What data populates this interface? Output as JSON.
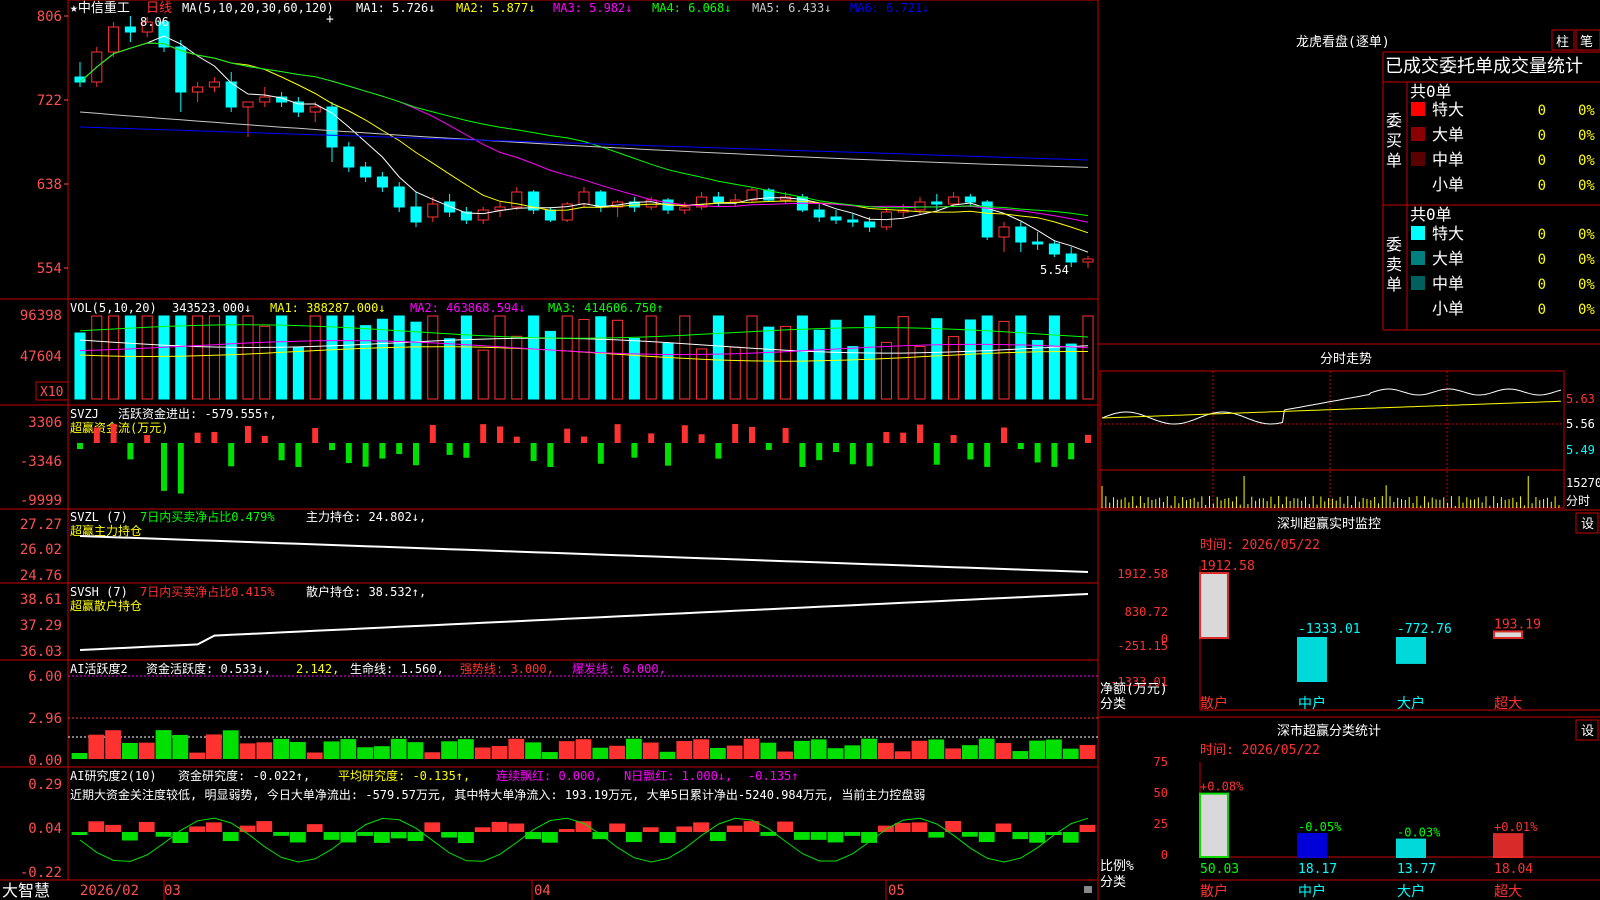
{
  "colors": {
    "up": "#ff3232",
    "down": "#00ffff",
    "frame": "#c80000",
    "axis_text": "#ff5050",
    "ma1": "#ffffff",
    "ma2": "#ffff00",
    "ma3": "#ff00ff",
    "ma4": "#00ff00",
    "ma5": "#c8c8c8",
    "ma6": "#0000ff",
    "green_bar": "#00e000",
    "label_yellow": "#ffff00",
    "title_white": "#ffffff"
  },
  "main": {
    "stock_name": "★中信重工",
    "period": "日线",
    "ma_params": "MA(5,10,20,30,60,120)",
    "ma1": "MA1: 5.726↓",
    "ma2": "MA2: 5.877↓",
    "ma3": "MA3: 5.982↓",
    "ma4": "MA4: 6.068↓",
    "ma5": "MA5: 6.433↓",
    "ma6": "MA6: 6.721↓",
    "cross": "+",
    "high_label": "8.06",
    "low_label": "5.54",
    "yticks": [
      "806",
      "722",
      "638",
      "554"
    ]
  },
  "vol": {
    "title": "VOL(5,10,20)",
    "val": "343523.000↓",
    "ma1": "MA1: 388287.000↓",
    "ma2": "MA2: 463868.594↓",
    "ma3": "MA3: 414606.750↑",
    "yticks": [
      "96398",
      "47604"
    ],
    "unit": "X10"
  },
  "svzj": {
    "title": "SVZJ",
    "desc": "活跃资金进出: -579.555↑,",
    "sub": "超赢资金流(万元)",
    "yticks": [
      "3306",
      "-3346",
      "-9999"
    ]
  },
  "svzl": {
    "title": "SVZL (7)",
    "desc1": "7日内买卖净占比0.479%",
    "desc2": "主力持仓: 24.802↓,",
    "sub": "超赢主力持仓",
    "yticks": [
      "27.27",
      "26.02",
      "24.76"
    ]
  },
  "svsh": {
    "title": "SVSH (7)",
    "desc1": "7日内买卖净占比0.415%",
    "desc2": "散户持仓: 38.532↑,",
    "sub": "超赢散户持仓",
    "yticks": [
      "38.61",
      "37.29",
      "36.03"
    ]
  },
  "ai1": {
    "title": "AI活跃度2",
    "desc": "资金活跃度: 0.533↓,",
    "v2": "2.142,",
    "life": "生命线: 1.560,",
    "strong": "强势线: 3.000,",
    "burst": "爆发线: 6.000,",
    "yticks": [
      "6.00",
      "2.96",
      "0.00"
    ]
  },
  "ai2": {
    "title": "AI研究度2(10)",
    "desc": "资金研究度: -0.022↑,",
    "avg": "平均研究度: -0.135↑,",
    "lianxu": "连续飘红: 0.000,",
    "nri": "N日飘红: 1.000↓,",
    "last": "-0.135↑",
    "comment": "近期大资金关注度较低, 明显弱势, 今日大单净流出: -579.57万元, 其中特大单净流入: 193.19万元, 大单5日累计净出-5240.984万元, 当前主力控盘弱",
    "yticks": [
      "0.29",
      "0.04",
      "-0.22"
    ]
  },
  "xaxis": {
    "brand": "大智慧",
    "labels": [
      "2026/02",
      "03",
      "04",
      "05"
    ]
  },
  "right": {
    "dragon_title": "龙虎看盘(逐单)",
    "btn_zhu": "柱",
    "btn_bi": "笔",
    "table_title": "已成交委托单成交量统计",
    "buy_total": "共0单",
    "sell_total": "共0单",
    "buy_label": "委买单",
    "sell_label": "委卖单",
    "rows": [
      {
        "name": "特大",
        "count": "0",
        "pct": "0%"
      },
      {
        "name": "大单",
        "count": "0",
        "pct": "0%"
      },
      {
        "name": "中单",
        "count": "0",
        "pct": "0%"
      },
      {
        "name": "小单",
        "count": "0",
        "pct": "0%"
      }
    ],
    "fenshi_title": "分时走势",
    "fenshi_yticks": [
      "5.63",
      "5.56",
      "5.49"
    ],
    "fenshi_vol": "15270",
    "fenshi_unit": "分时",
    "sz_title": "深圳超赢实时监控",
    "sz_time": "时间: 2026/05/22",
    "sz_yticks": [
      "1912.58",
      "830.72",
      "0",
      "-251.15",
      "-1333.01"
    ],
    "sz_ylabel": "净额(万元)",
    "sz_cat_label": "分类",
    "sz_setting": "设",
    "class_title": "深市超赢分类统计",
    "class_time": "时间: 2026/05/22",
    "class_yticks": [
      "75",
      "50",
      "25",
      "0"
    ],
    "class_ylabel": "比例%",
    "class_cat_label": "分类",
    "class_setting": "设"
  },
  "chart_data": [
    {
      "type": "candlestick",
      "title": "中信重工 日线",
      "ylim": [
        5.54,
        8.06
      ],
      "price_levels": [
        8.06,
        7.22,
        6.38,
        5.54
      ],
      "series_note": "daily bars from 2026/02 to 2026/05/22",
      "ohlc": [
        [
          7.45,
          7.6,
          7.35,
          7.4
        ],
        [
          7.4,
          7.75,
          7.35,
          7.7
        ],
        [
          7.7,
          8.0,
          7.65,
          7.95
        ],
        [
          7.95,
          8.06,
          7.8,
          7.9
        ],
        [
          7.9,
          8.05,
          7.85,
          8.0
        ],
        [
          8.0,
          8.02,
          7.7,
          7.75
        ],
        [
          7.75,
          7.82,
          7.1,
          7.3
        ],
        [
          7.3,
          7.4,
          7.2,
          7.35
        ],
        [
          7.35,
          7.45,
          7.3,
          7.4
        ],
        [
          7.4,
          7.5,
          7.1,
          7.15
        ],
        [
          7.15,
          7.2,
          6.85,
          7.2
        ],
        [
          7.2,
          7.35,
          7.15,
          7.25
        ],
        [
          7.25,
          7.3,
          7.15,
          7.2
        ],
        [
          7.2,
          7.25,
          7.05,
          7.1
        ],
        [
          7.1,
          7.2,
          7.0,
          7.15
        ],
        [
          7.15,
          7.2,
          6.6,
          6.75
        ],
        [
          6.75,
          6.8,
          6.5,
          6.55
        ],
        [
          6.55,
          6.6,
          6.4,
          6.45
        ],
        [
          6.45,
          6.5,
          6.3,
          6.35
        ],
        [
          6.35,
          6.4,
          6.1,
          6.15
        ],
        [
          6.15,
          6.3,
          5.95,
          6.0
        ],
        [
          6.05,
          6.25,
          6.0,
          6.18
        ],
        [
          6.2,
          6.28,
          6.05,
          6.1
        ],
        [
          6.1,
          6.15,
          5.98,
          6.02
        ],
        [
          6.02,
          6.15,
          5.98,
          6.12
        ],
        [
          6.12,
          6.2,
          6.05,
          6.15
        ],
        [
          6.15,
          6.35,
          6.12,
          6.3
        ],
        [
          6.3,
          6.32,
          6.08,
          6.12
        ],
        [
          6.12,
          6.15,
          6.0,
          6.02
        ],
        [
          6.02,
          6.2,
          6.0,
          6.18
        ],
        [
          6.18,
          6.35,
          6.15,
          6.3
        ],
        [
          6.3,
          6.32,
          6.1,
          6.15
        ],
        [
          6.15,
          6.22,
          6.05,
          6.2
        ],
        [
          6.2,
          6.25,
          6.1,
          6.15
        ],
        [
          6.15,
          6.25,
          6.12,
          6.22
        ],
        [
          6.22,
          6.24,
          6.08,
          6.12
        ],
        [
          6.12,
          6.2,
          6.08,
          6.15
        ],
        [
          6.15,
          6.3,
          6.12,
          6.25
        ],
        [
          6.25,
          6.3,
          6.15,
          6.2
        ],
        [
          6.2,
          6.28,
          6.15,
          6.22
        ],
        [
          6.22,
          6.35,
          6.2,
          6.32
        ],
        [
          6.32,
          6.34,
          6.2,
          6.22
        ],
        [
          6.22,
          6.3,
          6.18,
          6.25
        ],
        [
          6.25,
          6.28,
          6.1,
          6.12
        ],
        [
          6.12,
          6.18,
          6.0,
          6.05
        ],
        [
          6.05,
          6.12,
          5.98,
          6.02
        ],
        [
          6.02,
          6.08,
          5.95,
          6.0
        ],
        [
          6.0,
          6.05,
          5.9,
          5.95
        ],
        [
          5.95,
          6.15,
          5.92,
          6.1
        ],
        [
          6.1,
          6.18,
          6.05,
          6.12
        ],
        [
          6.12,
          6.25,
          6.08,
          6.2
        ],
        [
          6.2,
          6.28,
          6.12,
          6.18
        ],
        [
          6.18,
          6.3,
          6.15,
          6.25
        ],
        [
          6.25,
          6.28,
          6.15,
          6.2
        ],
        [
          6.2,
          6.22,
          5.82,
          5.85
        ],
        [
          5.85,
          6.0,
          5.7,
          5.95
        ],
        [
          5.95,
          6.0,
          5.7,
          5.8
        ],
        [
          5.8,
          5.9,
          5.72,
          5.78
        ],
        [
          5.78,
          5.82,
          5.65,
          5.68
        ],
        [
          5.68,
          5.75,
          5.55,
          5.6
        ],
        [
          5.6,
          5.66,
          5.54,
          5.63
        ]
      ]
    }
  ],
  "sz_monitor": {
    "type": "bar",
    "categories": [
      "散户",
      "中户",
      "大户",
      "超大"
    ],
    "values": [
      1912.58,
      -1333.01,
      -772.76,
      193.19
    ],
    "value_labels": [
      "1912.58",
      "-1333.01",
      "-772.76",
      "193.19"
    ]
  },
  "class_stats": {
    "type": "bar",
    "categories": [
      "散户",
      "中户",
      "大户",
      "超大"
    ],
    "values": [
      50.03,
      18.17,
      13.77,
      18.04
    ],
    "value_labels": [
      "50.03",
      "18.17",
      "13.77",
      "18.04"
    ],
    "changes": [
      "+0.08%",
      "-0.05%",
      "-0.03%",
      "+0.01%"
    ]
  }
}
